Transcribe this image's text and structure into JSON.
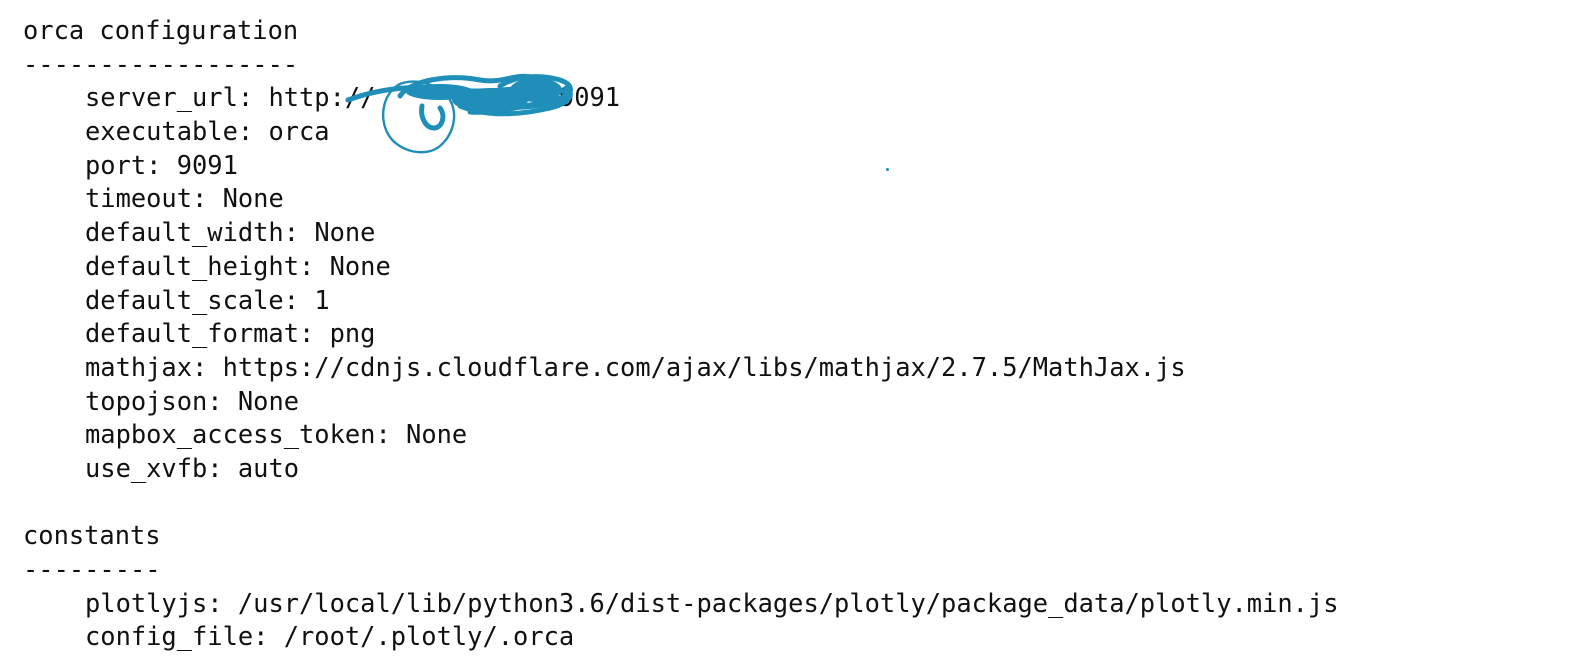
{
  "sections": [
    {
      "title": "orca configuration",
      "rule": "------------------",
      "rows": [
        {
          "key": "server_url",
          "value": "http://",
          "value_suffix": ":9091",
          "redacted": true
        },
        {
          "key": "executable",
          "value": "orca"
        },
        {
          "key": "port",
          "value": "9091"
        },
        {
          "key": "timeout",
          "value": "None"
        },
        {
          "key": "default_width",
          "value": "None"
        },
        {
          "key": "default_height",
          "value": "None"
        },
        {
          "key": "default_scale",
          "value": "1"
        },
        {
          "key": "default_format",
          "value": "png"
        },
        {
          "key": "mathjax",
          "value": "https://cdnjs.cloudflare.com/ajax/libs/mathjax/2.7.5/MathJax.js"
        },
        {
          "key": "topojson",
          "value": "None"
        },
        {
          "key": "mapbox_access_token",
          "value": "None"
        },
        {
          "key": "use_xvfb",
          "value": "auto"
        }
      ]
    },
    {
      "title": "constants",
      "rule": "---------",
      "rows": [
        {
          "key": "plotlyjs",
          "value": "/usr/local/lib/python3.6/dist-packages/plotly/package_data/plotly.min.js"
        },
        {
          "key": "config_file",
          "value": "/root/.plotly/.orca"
        }
      ]
    }
  ],
  "colors": {
    "text": "#111111",
    "background": "#ffffff",
    "redaction_scribble": "#1f8fba"
  }
}
